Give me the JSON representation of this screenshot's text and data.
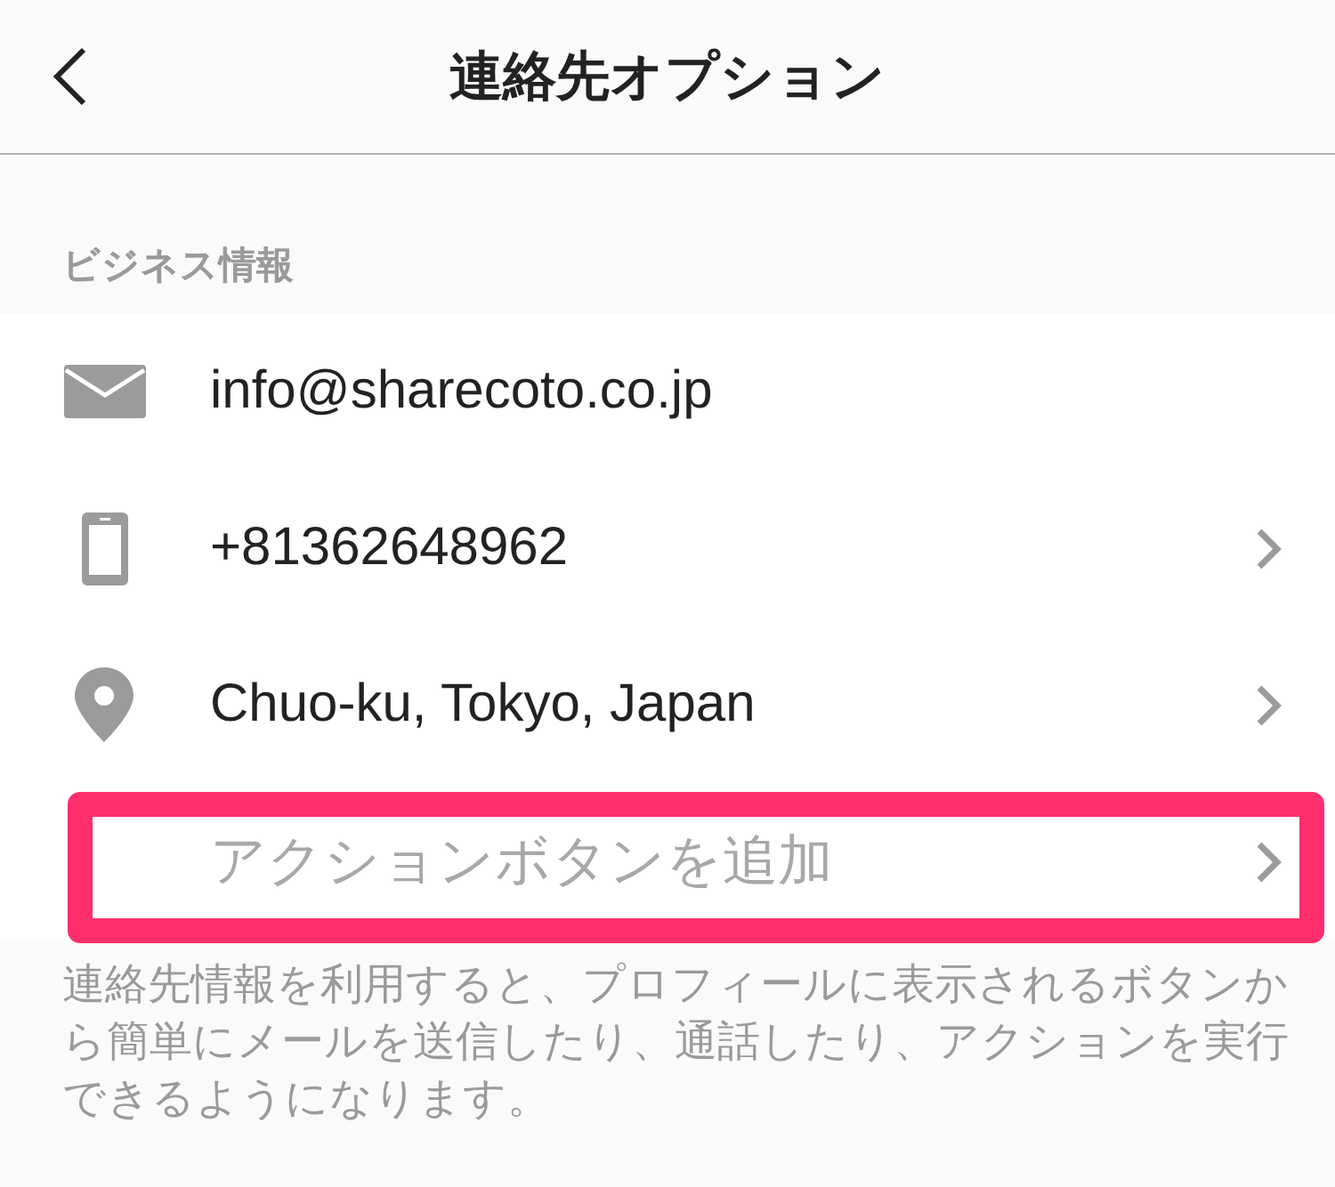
{
  "header": {
    "title": "連絡先オプション"
  },
  "section": {
    "label": "ビジネス情報",
    "rows": [
      {
        "kind": "email",
        "text": "info@sharecoto.co.jp",
        "chevron": false,
        "highlighted": false
      },
      {
        "kind": "phone",
        "text": "+81362648962",
        "chevron": true,
        "highlighted": false
      },
      {
        "kind": "location",
        "text": "Chuo-ku, Tokyo, Japan",
        "chevron": true,
        "highlighted": false
      },
      {
        "kind": "action",
        "text": "アクションボタンを追加",
        "chevron": true,
        "highlighted": true
      }
    ]
  },
  "footer": {
    "note": "連絡先情報を利用すると、プロフィールに表示されるボタンから簡単にメールを送信したり、通話したり、アクションを実行できるようになります。"
  }
}
